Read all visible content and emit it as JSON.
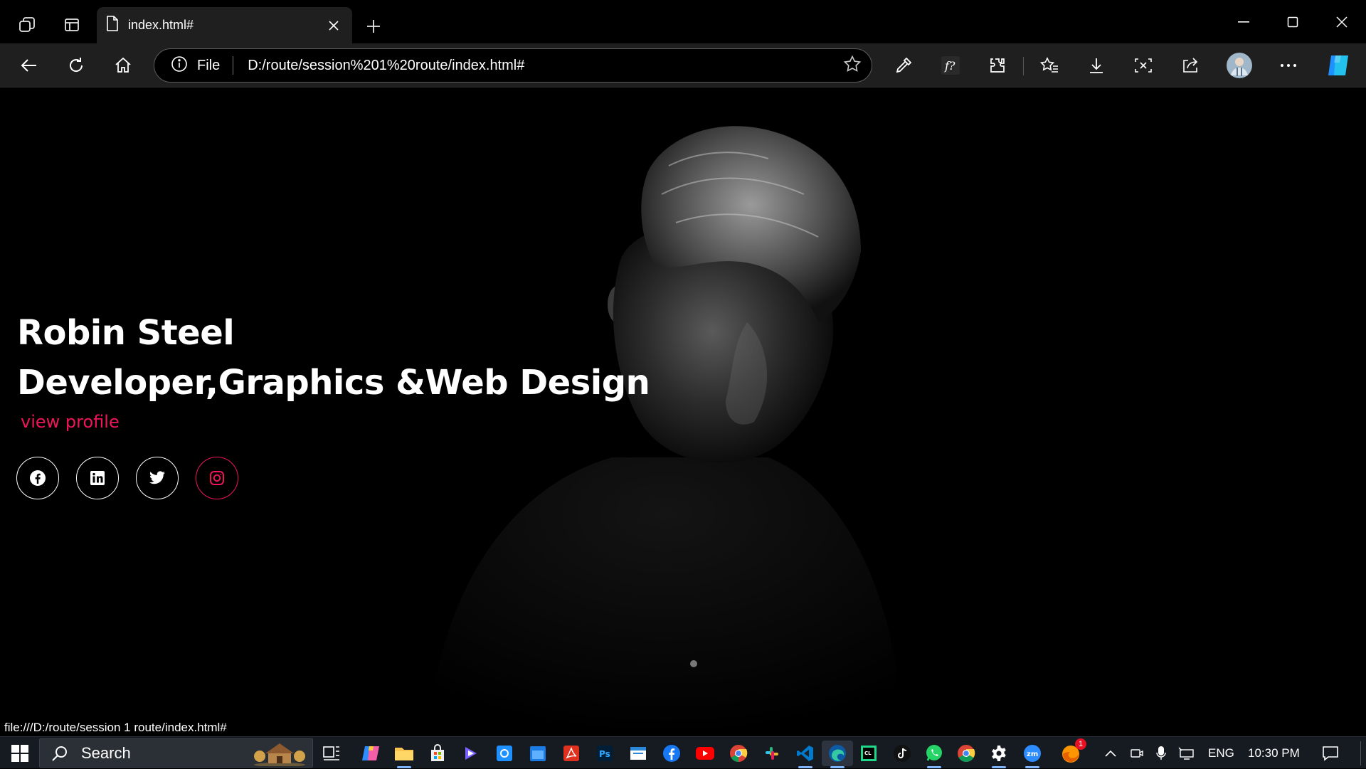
{
  "browser": {
    "tab_title": "index.html#",
    "address_label": "File",
    "url": "D:/route/session%201%20route/index.html#",
    "status_url": "file:///D:/route/session 1 route/index.html#"
  },
  "page": {
    "name": "Robin Steel",
    "role": "Developer,Graphics &Web Design",
    "profile_link": "view profile",
    "socials": [
      {
        "icon": "facebook-icon"
      },
      {
        "icon": "linkedin-icon"
      },
      {
        "icon": "twitter-icon"
      },
      {
        "icon": "instagram-icon",
        "active": true
      }
    ]
  },
  "taskbar": {
    "search_placeholder": "Search",
    "language": "ENG",
    "time": "10:30 PM",
    "notification_badge": "1"
  },
  "colors": {
    "accent": "#f0145a",
    "background": "#000000",
    "chrome": "#1f1f1f",
    "taskbar": "#161b22"
  }
}
